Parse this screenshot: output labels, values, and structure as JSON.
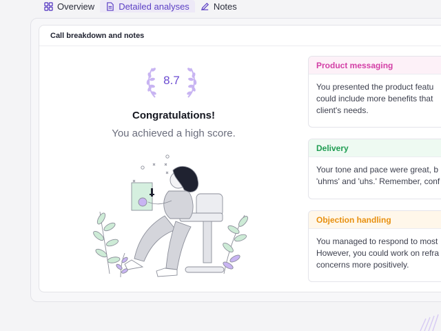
{
  "tabs": [
    {
      "label": "Overview",
      "icon": "grid-icon",
      "active": false
    },
    {
      "label": "Detailed analyses",
      "icon": "document-icon",
      "active": true
    },
    {
      "label": "Notes",
      "icon": "pencil-icon",
      "active": false
    }
  ],
  "card": {
    "title": "Call breakdown and notes",
    "score": "8.7",
    "congrats": "Congratulations!",
    "subtitle": "You achieved a high score."
  },
  "feedback": [
    {
      "title": "Product messaging",
      "color": "#d33fa6",
      "bg": "#fdf1f8",
      "lines": [
        "You presented the product featu",
        "could include more benefits that",
        "client's needs."
      ]
    },
    {
      "title": "Delivery",
      "color": "#1f9d52",
      "bg": "#eefaf2",
      "lines": [
        "Your tone and pace were great, b",
        "'uhms' and 'uhs.' Remember, conf"
      ]
    },
    {
      "title": "Objection handling",
      "color": "#e8900f",
      "bg": "#fff7ea",
      "lines": [
        "You managed to respond to most",
        "However, you could work on refra",
        "concerns more positively."
      ]
    }
  ],
  "colors": {
    "accent": "#6b4bd1",
    "laurel": "#c8b4f2",
    "leaf": "#cdebd6"
  }
}
